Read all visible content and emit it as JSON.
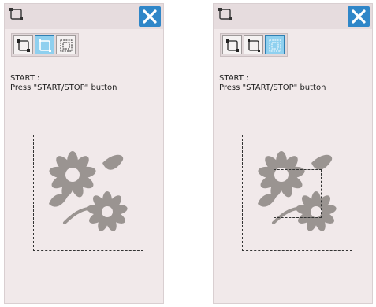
{
  "panels": [
    {
      "message_line1": "START :",
      "message_line2": "Press \"START/STOP\" button",
      "selected_mode": 2
    },
    {
      "message_line1": "START :",
      "message_line2": "Press \"START/STOP\" button",
      "selected_mode": 3
    }
  ],
  "icons": {
    "title": "outline-frame-icon",
    "close": "close-icon",
    "modes": [
      "outline-frame-icon",
      "outline-frame-alt-icon",
      "quilting-frame-icon"
    ]
  },
  "colors": {
    "panel_bg": "#f1e9ea",
    "close_bg": "#2f86c8",
    "selected_mode_bg": "#8fd0ef",
    "flower": "#9a9491"
  }
}
